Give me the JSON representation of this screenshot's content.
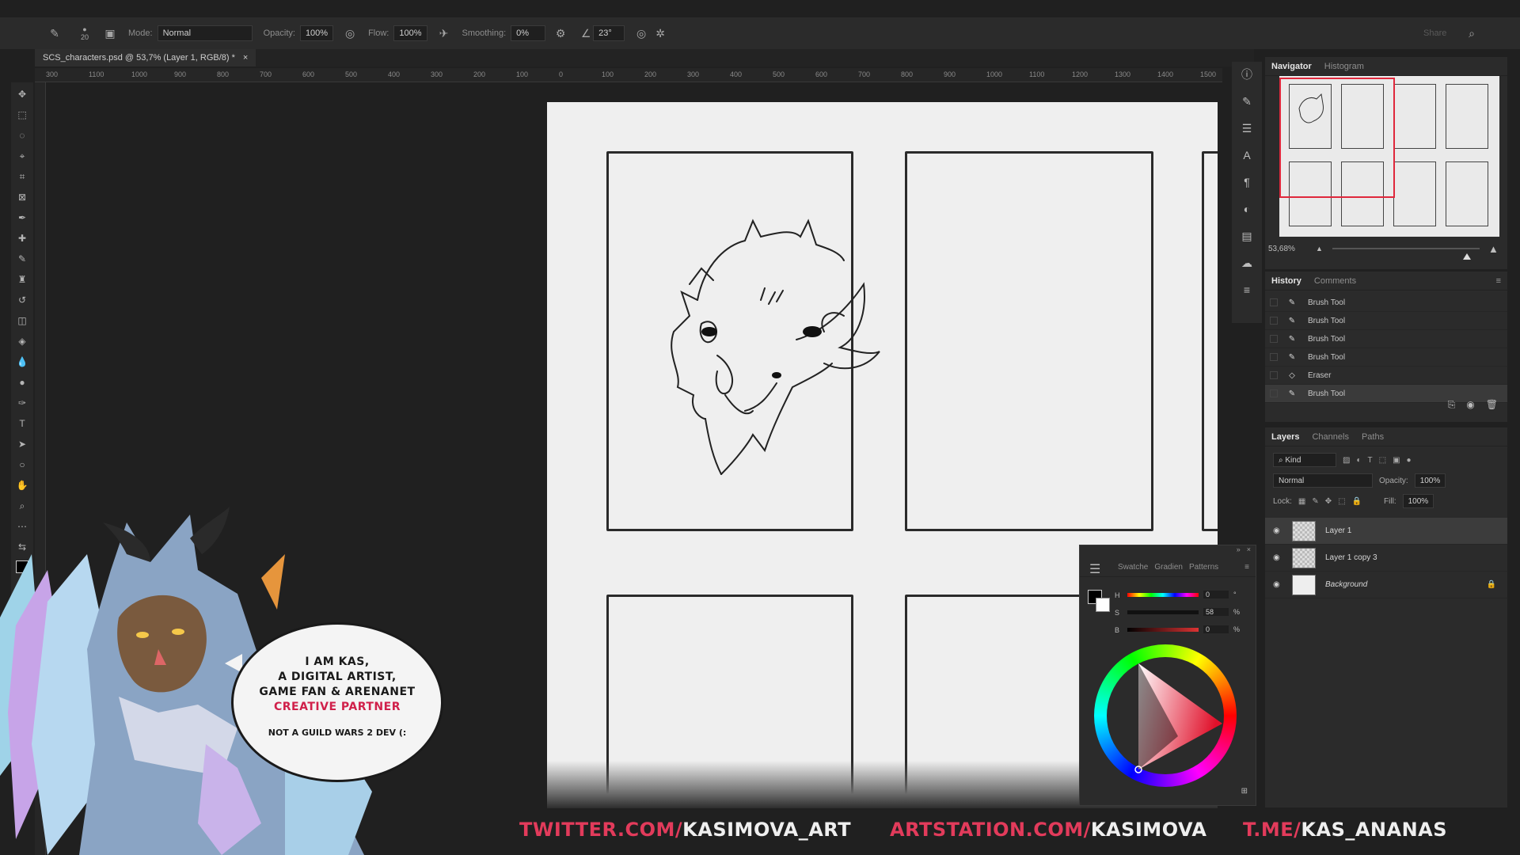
{
  "options_bar": {
    "brush_size": "20",
    "mode_label": "Mode:",
    "mode_value": "Normal",
    "opacity_label": "Opacity:",
    "opacity_value": "100%",
    "flow_label": "Flow:",
    "flow_value": "100%",
    "smoothing_label": "Smoothing:",
    "smoothing_value": "0%",
    "angle_value": "23°",
    "share_label": "Share"
  },
  "document": {
    "tab_title": "SCS_characters.psd @ 53,7% (Layer 1, RGB/8) *",
    "close_symbol": "×"
  },
  "ruler_ticks": [
    "300",
    "1100",
    "1000",
    "900",
    "800",
    "700",
    "600",
    "500",
    "400",
    "300",
    "200",
    "100",
    "0",
    "100",
    "200",
    "300",
    "400",
    "500",
    "600",
    "700",
    "800",
    "900",
    "1000",
    "1100",
    "1200",
    "1300",
    "1400",
    "1500"
  ],
  "navigator": {
    "tabs": [
      "Navigator",
      "Histogram"
    ],
    "zoom": "53,68%"
  },
  "history": {
    "tabs": [
      "History",
      "Comments"
    ],
    "items": [
      {
        "label": "Brush Tool",
        "icon": "brush-icon"
      },
      {
        "label": "Brush Tool",
        "icon": "brush-icon"
      },
      {
        "label": "Brush Tool",
        "icon": "brush-icon"
      },
      {
        "label": "Brush Tool",
        "icon": "brush-icon"
      },
      {
        "label": "Eraser",
        "icon": "eraser-icon"
      },
      {
        "label": "Brush Tool",
        "icon": "brush-icon"
      }
    ]
  },
  "layers": {
    "tabs": [
      "Layers",
      "Channels",
      "Paths"
    ],
    "filter": "Kind",
    "blend": "Normal",
    "opacity_label": "Opacity:",
    "opacity_value": "100%",
    "lock_label": "Lock:",
    "fill_label": "Fill:",
    "fill_value": "100%",
    "items": [
      {
        "name": "Layer 1"
      },
      {
        "name": "Layer 1 copy 3"
      },
      {
        "name": "Background"
      }
    ]
  },
  "color_panel": {
    "tabs": [
      "Swatche",
      "Gradien",
      "Patterns"
    ],
    "h_label": "H",
    "h_value": "0",
    "h_unit": "°",
    "s_label": "S",
    "s_value": "58",
    "s_unit": "%",
    "b_label": "B",
    "b_value": "0",
    "b_unit": "%"
  },
  "overlay": {
    "bubble_line1": "I AM KAS,",
    "bubble_line2": "A DIGITAL ARTIST,",
    "bubble_line3": "GAME FAN  &  ARENANET",
    "bubble_line4": "CREATIVE PARTNER",
    "bubble_line5": "NOT A GUILD WARS 2 DEV (:",
    "twitter_prefix": "TWITTER.COM/",
    "twitter_handle": "KASIMOVA_ART",
    "artstation_prefix": "ARTSTATION.COM/",
    "artstation_handle": "KASIMOVA",
    "telegram_prefix": "T.ME/",
    "telegram_handle": "KAS_ANANAS"
  }
}
